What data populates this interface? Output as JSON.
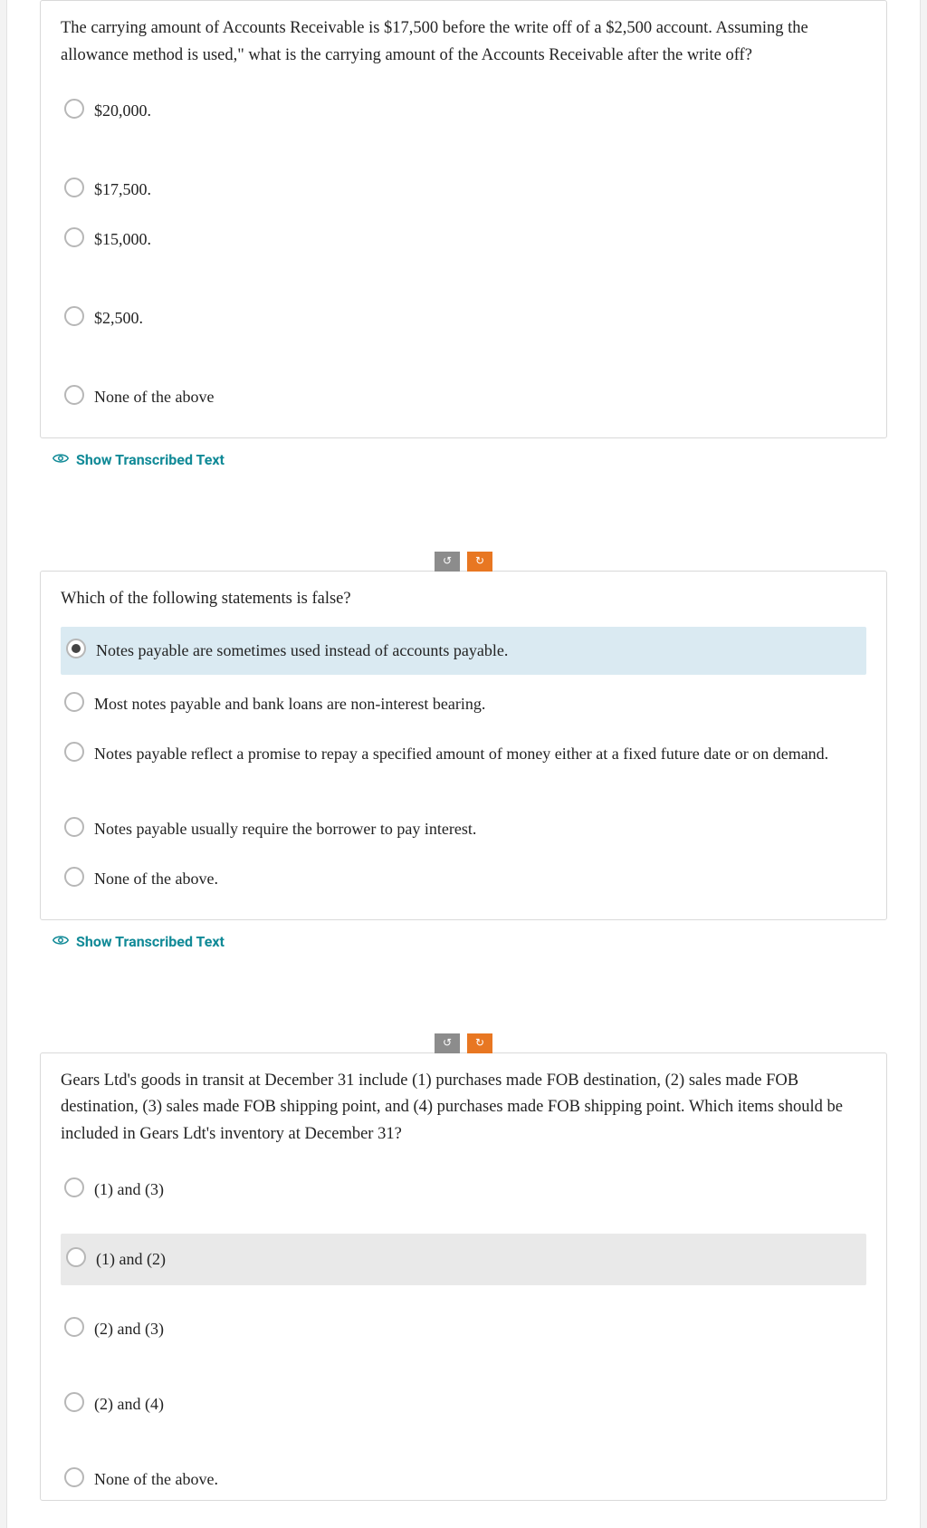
{
  "questions": [
    {
      "prompt": "The carrying amount of Accounts Receivable is $17,500 before the write off of a $2,500 account. Assuming the allowance method is used,\" what is the carrying amount of the Accounts Receivable after the write off?",
      "options": [
        {
          "label": "$20,000.",
          "selected": false
        },
        {
          "label": "$17,500.",
          "selected": false
        },
        {
          "label": "$15,000.",
          "selected": false
        },
        {
          "label": "$2,500.",
          "selected": false
        },
        {
          "label": "None of the above",
          "selected": false
        }
      ],
      "show_transcribed": "Show Transcribed Text"
    },
    {
      "prompt": "Which of the following statements is false?",
      "options": [
        {
          "label": "Notes payable are sometimes used instead of accounts payable.",
          "selected": true
        },
        {
          "label": "Most notes payable and bank loans are non-interest bearing.",
          "selected": false
        },
        {
          "label": "Notes payable reflect a promise to repay a specified amount of money either at a fixed future date or on demand.",
          "selected": false
        },
        {
          "label": "Notes payable usually require the borrower to pay interest.",
          "selected": false
        },
        {
          "label": "None of the above.",
          "selected": false
        }
      ],
      "show_transcribed": "Show Transcribed Text"
    },
    {
      "prompt": "Gears Ltd's goods in transit at December 31 include (1) purchases made FOB destination, (2) sales made FOB destination, (3) sales made FOB shipping point, and (4) purchases made FOB shipping point. Which items should be included in Gears Ldt's inventory at December 31?",
      "options": [
        {
          "label": "(1) and (3)",
          "selected": false
        },
        {
          "label": "(1) and (2)",
          "selected": false
        },
        {
          "label": "(2) and (3)",
          "selected": false
        },
        {
          "label": "(2) and (4)",
          "selected": false
        },
        {
          "label": "None of the above.",
          "selected": false
        }
      ]
    }
  ],
  "nav": {
    "left": "↺",
    "right": "↻"
  }
}
